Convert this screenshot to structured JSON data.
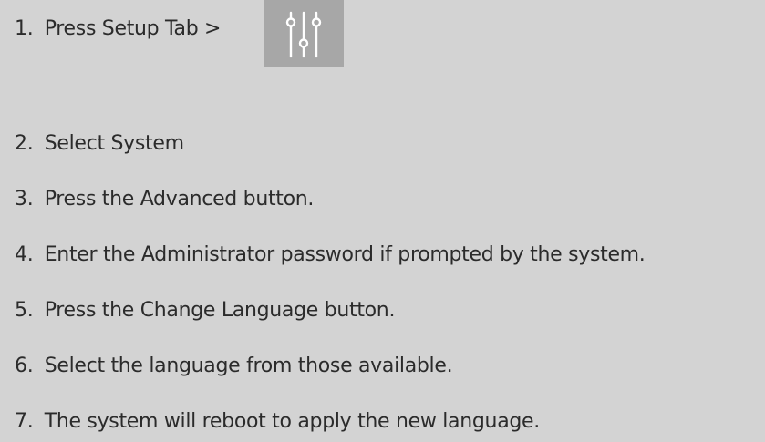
{
  "steps": [
    {
      "number": "1.",
      "text": "Press Setup Tab >",
      "icon": "setup-sliders-icon"
    },
    {
      "number": "2.",
      "text": "Select System"
    },
    {
      "number": "3.",
      "text": "Press the Advanced button."
    },
    {
      "number": "4.",
      "text": "Enter the Administrator password if prompted by the system."
    },
    {
      "number": "5.",
      "text": "Press the Change Language button."
    },
    {
      "number": "6.",
      "text": "Select the language from those available."
    },
    {
      "number": "7.",
      "text": "The system will reboot to apply the new language."
    }
  ],
  "colors": {
    "background": "#d3d3d3",
    "text": "#2b2b2b",
    "icon_background": "#a7a7a7",
    "icon_foreground": "#ffffff"
  }
}
